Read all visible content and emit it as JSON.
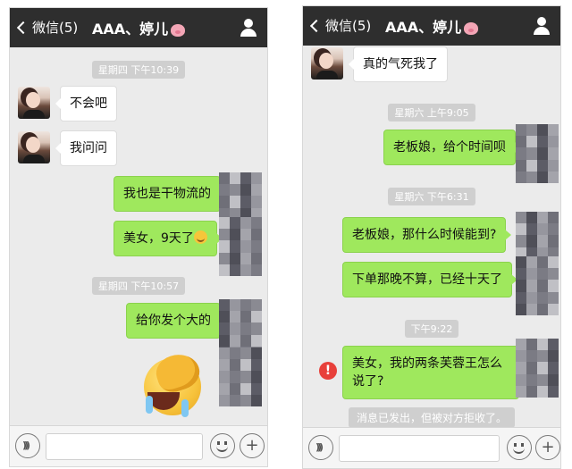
{
  "header": {
    "back_label": "微信(5)",
    "title": "AAA、婷儿"
  },
  "left": {
    "messages": [
      {
        "text": "不会吧"
      },
      {
        "text": "我问问"
      },
      {
        "text": "我也是干物流的"
      },
      {
        "text": "美女，9天了"
      }
    ],
    "timestamps": [
      "星期四 下午10:39",
      "星期四 下午10:57"
    ],
    "sticker_msg": "给你发个大的"
  },
  "right": {
    "messages": [
      {
        "text": "真的气死我了"
      },
      {
        "text": "老板娘，给个时间呗"
      },
      {
        "text": "老板娘，那什么时候能到?"
      },
      {
        "text": "下单那晚不算，已经十天了"
      },
      {
        "text": "美女，我的两条芙蓉王怎么说了?"
      }
    ],
    "timestamps": [
      "星期六 上午9:05",
      "星期六 下午6:31",
      "下午9:22"
    ],
    "notice": "消息已发出，但被对方拒收了。",
    "error_mark": "!"
  },
  "colors": {
    "topbar": "#2e2e2e",
    "bubble_out": "#9fe85d",
    "bubble_in": "#ffffff",
    "background": "#ebebeb",
    "error": "#e8403a"
  },
  "icons": [
    "back-chevron-icon",
    "pig-emoji-icon",
    "contact-profile-icon",
    "voice-icon",
    "emoji-icon",
    "plus-icon",
    "facepalm-sticker",
    "error-icon"
  ]
}
